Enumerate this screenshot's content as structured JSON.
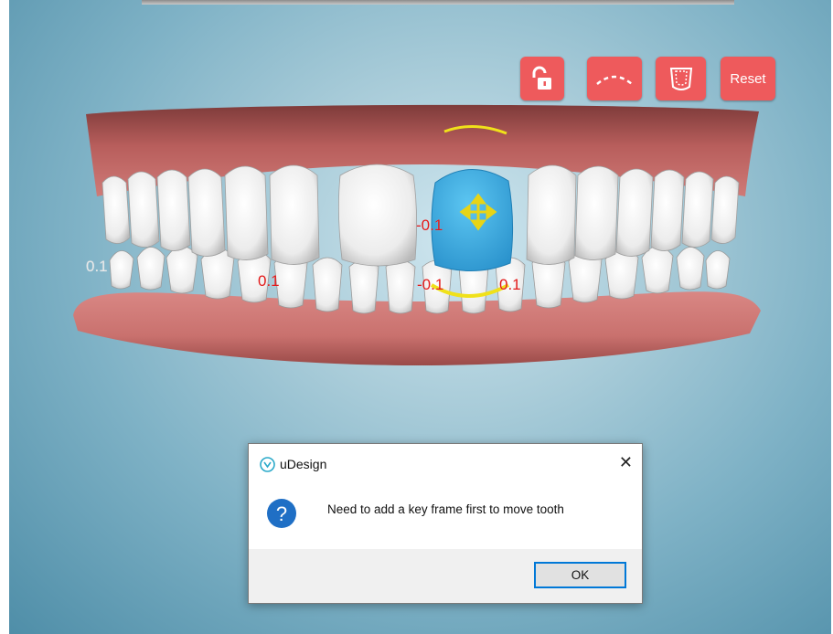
{
  "toolbar": {
    "lock_icon": "unlock-icon",
    "arch_icon": "dashed-arch-icon",
    "tooth_outline_icon": "tooth-outline-icon",
    "reset_label": "Reset"
  },
  "measurements": {
    "upper_center": "-0.1",
    "lower_left": "0.1",
    "lower_center": "-0.1",
    "lower_right": "0.1",
    "left_edge": "0.1"
  },
  "colors": {
    "toolbar_button": "#ee5a5c",
    "selected_tooth": "#3aaee6",
    "gingiva": "#c86d6b",
    "measurement_text": "#e31919",
    "handle": "#f0e11a"
  },
  "dialog": {
    "title": "uDesign",
    "close_label": "✕",
    "message": "Need to add a key frame first to move tooth",
    "ok_label": "OK"
  }
}
